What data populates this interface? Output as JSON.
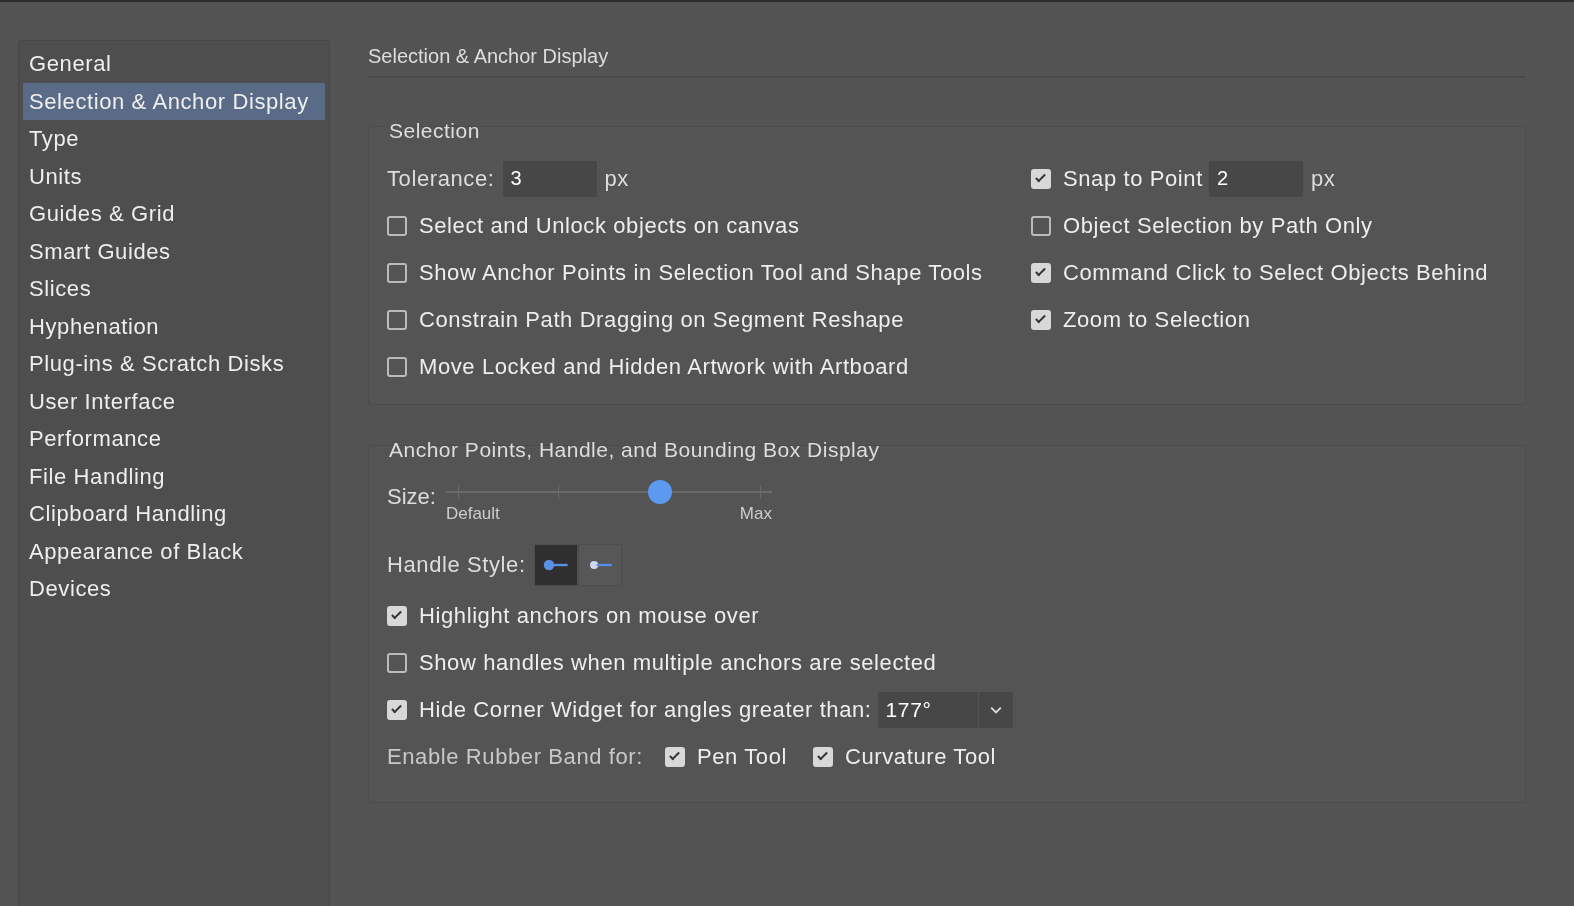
{
  "sidebar": {
    "items": [
      {
        "label": "General",
        "selected": false
      },
      {
        "label": "Selection & Anchor Display",
        "selected": true
      },
      {
        "label": "Type",
        "selected": false
      },
      {
        "label": "Units",
        "selected": false
      },
      {
        "label": "Guides & Grid",
        "selected": false
      },
      {
        "label": "Smart Guides",
        "selected": false
      },
      {
        "label": "Slices",
        "selected": false
      },
      {
        "label": "Hyphenation",
        "selected": false
      },
      {
        "label": "Plug-ins & Scratch Disks",
        "selected": false
      },
      {
        "label": "User Interface",
        "selected": false
      },
      {
        "label": "Performance",
        "selected": false
      },
      {
        "label": "File Handling",
        "selected": false
      },
      {
        "label": "Clipboard Handling",
        "selected": false
      },
      {
        "label": "Appearance of Black",
        "selected": false
      },
      {
        "label": "Devices",
        "selected": false
      }
    ]
  },
  "page_title": "Selection & Anchor Display",
  "selection": {
    "title": "Selection",
    "tolerance": {
      "label": "Tolerance:",
      "value": "3",
      "unit": "px"
    },
    "snap_to_point": {
      "label": "Snap to Point",
      "checked": true,
      "value": "2",
      "unit": "px"
    },
    "left_options": [
      {
        "label": "Select and Unlock objects on canvas",
        "checked": false
      },
      {
        "label": "Show Anchor Points in Selection Tool and Shape Tools",
        "checked": false
      },
      {
        "label": "Constrain Path Dragging on Segment Reshape",
        "checked": false
      },
      {
        "label": "Move Locked and Hidden Artwork with Artboard",
        "checked": false
      }
    ],
    "right_options": [
      {
        "label": "Object Selection by Path Only",
        "checked": false
      },
      {
        "label": "Command Click to Select Objects Behind",
        "checked": true
      },
      {
        "label": "Zoom to Selection",
        "checked": true
      }
    ]
  },
  "anchor_display": {
    "title": "Anchor Points, Handle, and Bounding Box Display",
    "size": {
      "label": "Size:",
      "level": 0.67,
      "min_label": "Default",
      "max_label": "Max"
    },
    "handle_style": {
      "label": "Handle Style:",
      "options": [
        {
          "selected": true
        },
        {
          "selected": false
        }
      ]
    },
    "options": [
      {
        "label": "Highlight anchors on mouse over",
        "checked": true
      },
      {
        "label": "Show handles when multiple anchors are selected",
        "checked": false
      }
    ],
    "corner_widget": {
      "label": "Hide Corner Widget for angles greater than:",
      "checked": true,
      "value": "177°"
    },
    "rubber_band": {
      "label": "Enable Rubber Band for:",
      "options": [
        {
          "label": "Pen Tool",
          "checked": true
        },
        {
          "label": "Curvature Tool",
          "checked": true
        }
      ]
    }
  }
}
